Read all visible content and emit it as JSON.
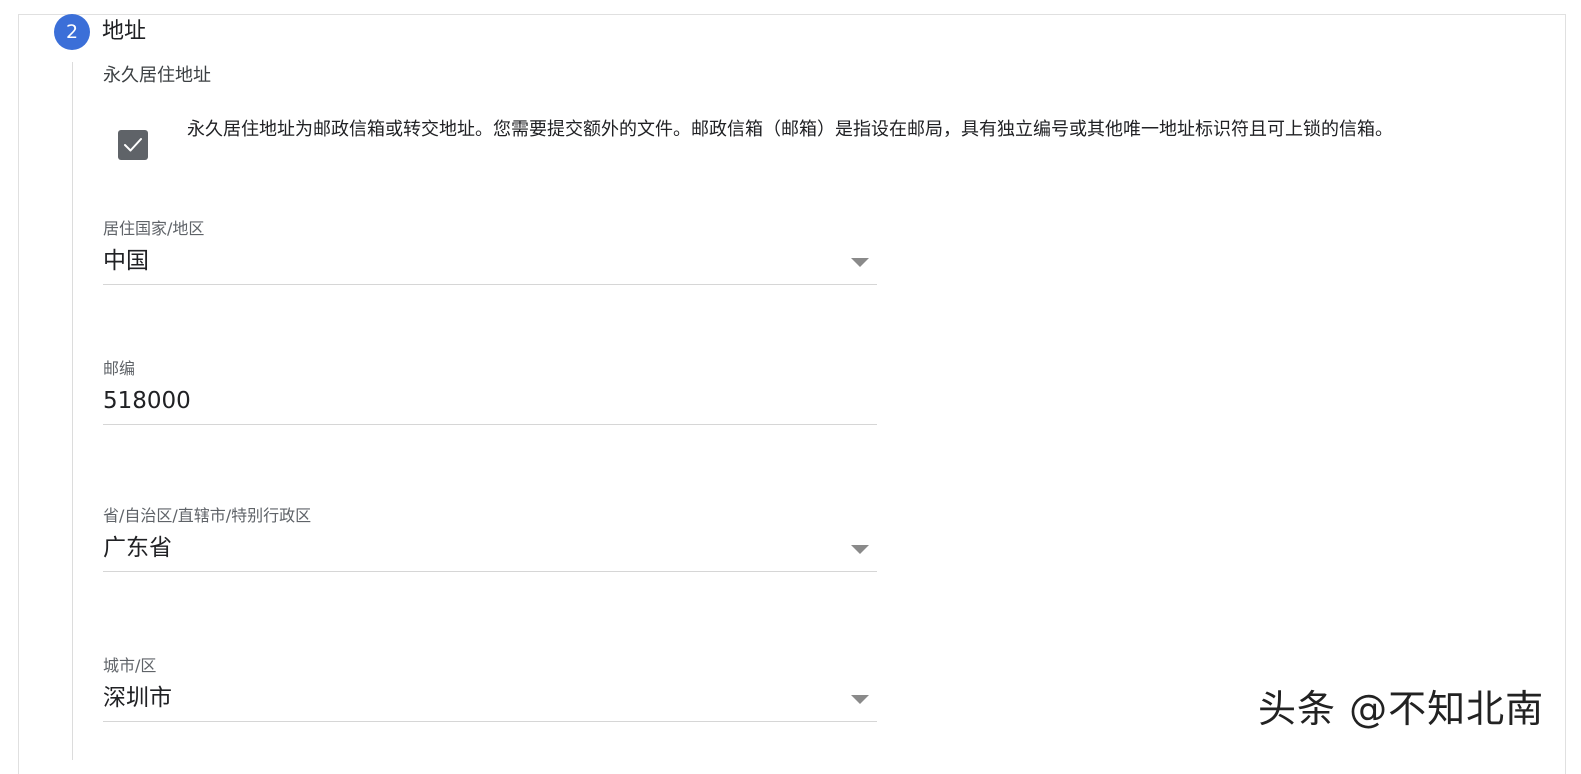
{
  "step": {
    "number": "2",
    "title": "地址"
  },
  "section": {
    "subheading": "永久居住地址",
    "checkbox_checked": true,
    "notice": "永久居住地址为邮政信箱或转交地址。您需要提交额外的文件。邮政信箱（邮箱）是指设在邮局，具有独立编号或其他唯一地址标识符且可上锁的信箱。"
  },
  "fields": {
    "country": {
      "label": "居住国家/地区",
      "value": "中国"
    },
    "postal_code": {
      "label": "邮编",
      "value": "518000"
    },
    "province": {
      "label": "省/自治区/直辖市/特别行政区",
      "value": "广东省"
    },
    "city": {
      "label": "城市/区",
      "value": "深圳市"
    }
  },
  "watermark": "头条 @不知北南",
  "colors": {
    "accent": "#3b6fd8",
    "checkbox": "#5f6368"
  }
}
